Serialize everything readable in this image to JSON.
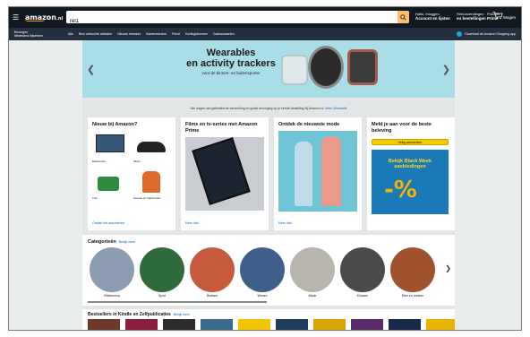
{
  "header": {
    "logo": "amazon",
    "logo_suffix": ".nl",
    "search_value": "rel1",
    "links": [
      {
        "top": "Hallo, Inloggen",
        "bottom": "Account en lijsten"
      },
      {
        "top": "Retourzendingen",
        "bottom": "en bestellingen"
      },
      {
        "top": "Probeer",
        "bottom": "Prime"
      }
    ],
    "cart_label": "Wagen",
    "cart_count": "0"
  },
  "subnav": {
    "location_top": "Bezorgen",
    "location_bottom": "Nederland bijwerken",
    "links": [
      "Alle",
      "Best verkochte artikelen",
      "Nieuwe releases",
      "Klantenservice",
      "Prime",
      "Kortingsbonnen",
      "Cadeaukaarten"
    ],
    "promo": "Download de Amazon Shopping app"
  },
  "hero": {
    "title_line1": "Wearables",
    "title_line2": "en activity trackers",
    "subtitle": "voor de binnen- en buitensporter"
  },
  "notice": {
    "text": "Alle dagen van gelimiteerde verzending en gratis bezorging op je eerste bestelling bij Amazon.nl.",
    "link": "Meer informatie"
  },
  "cards": [
    {
      "title": "Nieuw bij Amazon?",
      "items": [
        "Elektronica",
        "Mode",
        "Tuin",
        "Keuken en huishouden"
      ],
      "link": "Ontdek het assortiment"
    },
    {
      "title": "Films en tv-series met Amazon Prime",
      "link": "Meer info"
    },
    {
      "title": "Ontdek de nieuwste mode",
      "link": "Meer info"
    },
    {
      "title": "Meld je aan voor de beste beleving",
      "button": "Veilig aanmelden",
      "deal_text": "Bekijk Black Week aanbiedingen",
      "deal_pct": "-%"
    }
  ],
  "categories": {
    "heading": "Categorieën",
    "heading_link": "Bekijk meer",
    "items": [
      "Elektronica",
      "Sport",
      "Boeken",
      "Wonen",
      "Mode",
      "Klussen",
      "Eten en drinken"
    ]
  },
  "deals": {
    "heading": "Bestsellers in Kindle en Zelfpublicaties",
    "heading_link": "Bekijk meer"
  },
  "colors": {
    "nav_dark": "#131921",
    "nav_sub": "#232f3e",
    "search_button": "#febd69",
    "hero_bg": "#a9dde8",
    "link": "#0066c0",
    "signin_button": "#f7ca00"
  }
}
